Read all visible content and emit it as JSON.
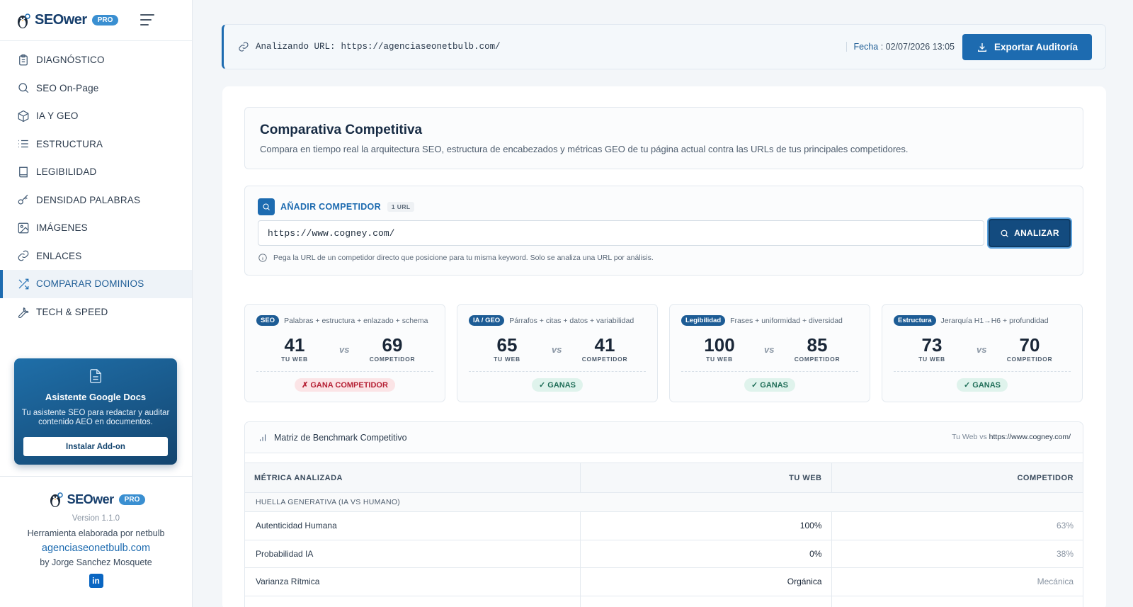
{
  "app": {
    "name": "SEOwer",
    "badge": "PRO"
  },
  "sidebar": {
    "items": [
      {
        "label": "DIAGNÓSTICO",
        "icon": "clipboard-icon"
      },
      {
        "label": "SEO On-Page",
        "icon": "search-icon"
      },
      {
        "label": "IA Y GEO",
        "icon": "cube-icon"
      },
      {
        "label": "ESTRUCTURA",
        "icon": "list-icon"
      },
      {
        "label": "LEGIBILIDAD",
        "icon": "book-icon"
      },
      {
        "label": "DENSIDAD PALABRAS",
        "icon": "key-icon"
      },
      {
        "label": "IMÁGENES",
        "icon": "image-icon"
      },
      {
        "label": "ENLACES",
        "icon": "link-icon"
      },
      {
        "label": "COMPARAR DOMINIOS",
        "icon": "shuffle-icon",
        "active": true
      },
      {
        "label": "TECH & SPEED",
        "icon": "wrench-icon"
      }
    ],
    "promo": {
      "title": "Asistente Google Docs",
      "description": "Tu asistente SEO para redactar y auditar contenido AEO en documentos.",
      "button": "Instalar Add-on"
    },
    "footer": {
      "version": "Version 1.1.0",
      "made_by": "Herramienta elaborada por netbulb",
      "link": "agenciaseonetbulb.com",
      "author": "by Jorge Sanchez Mosquete"
    }
  },
  "topbar": {
    "analyzing_label": "Analizando URL:",
    "url": "https://agenciaseonetbulb.com/",
    "date_label": "Fecha",
    "date_value": "02/07/2026 13:05",
    "export_button": "Exportar Auditoría"
  },
  "intro": {
    "title": "Comparativa Competitiva",
    "description": "Compara en tiempo real la arquitectura SEO, estructura de encabezados y métricas GEO de tu página actual contra las URLs de tus principales competidores."
  },
  "add_competitor": {
    "title": "AÑADIR COMPETIDOR",
    "count": "1 URL",
    "input_value": "https://www.cogney.com/",
    "button": "ANALIZAR",
    "hint": "Pega la URL de un competidor directo que posicione para tu misma keyword. Solo se analiza una URL por análisis."
  },
  "score_cards": [
    {
      "tag": "SEO",
      "subtitle": "Palabras + estructura + enlazado + schema",
      "you": "41",
      "competitor": "69",
      "result": "✗ GANA COMPETIDOR",
      "outcome": "lose"
    },
    {
      "tag": "IA / GEO",
      "subtitle": "Párrafos + citas + datos + variabilidad",
      "you": "65",
      "competitor": "41",
      "result": "✓ GANAS",
      "outcome": "win"
    },
    {
      "tag": "Legibilidad",
      "subtitle": "Frases + uniformidad + diversidad",
      "you": "100",
      "competitor": "85",
      "result": "✓ GANAS",
      "outcome": "win"
    },
    {
      "tag": "Estructura",
      "subtitle": "Jerarquía H1→H6 + profundidad",
      "you": "73",
      "competitor": "70",
      "result": "✓ GANAS",
      "outcome": "win"
    }
  ],
  "score_labels": {
    "you": "TU WEB",
    "competitor": "COMPETIDOR",
    "vs": "vs"
  },
  "benchmark": {
    "title": "Matriz de Benchmark Competitivo",
    "vs_prefix": "Tu Web vs",
    "vs_url": "https://www.cogney.com/",
    "columns": [
      "MÉTRICA ANALIZADA",
      "TU WEB",
      "COMPETIDOR"
    ],
    "group": "HUELLA GENERATIVA (IA VS HUMANO)",
    "rows": [
      {
        "metric": "Autenticidad Humana",
        "you": "100%",
        "competitor": "63%"
      },
      {
        "metric": "Probabilidad IA",
        "you": "0%",
        "competitor": "38%"
      },
      {
        "metric": "Varianza Rítmica",
        "you": "Orgánica",
        "competitor": "Mecánica"
      }
    ]
  }
}
